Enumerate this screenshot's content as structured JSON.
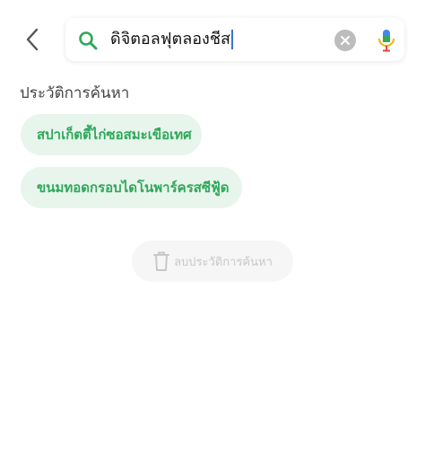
{
  "header": {
    "back_icon": "chevron-left-icon"
  },
  "search": {
    "value": "ดิจิตอลฟุตลองชีส",
    "search_icon": "search-icon",
    "clear_icon": "clear-icon",
    "mic_icon": "microphone-icon"
  },
  "history": {
    "title": "ประวัติการค้นหา",
    "items": [
      {
        "label": "สปาเก็ตตี้ไก่ซอสมะเขือเทศ"
      },
      {
        "label": "ขนมทอดกรอบไดโนพาร์ครสซีฟู้ด"
      }
    ],
    "clear_label": "ลบประวัติการค้นหา",
    "clear_icon": "trash-icon"
  },
  "colors": {
    "accent_green": "#2ea85a",
    "chip_bg": "#e8f5ec",
    "mic_red": "#e8453c",
    "mic_yellow": "#f4b400",
    "mic_green": "#34a853",
    "caret_blue": "#3b6fd8"
  }
}
